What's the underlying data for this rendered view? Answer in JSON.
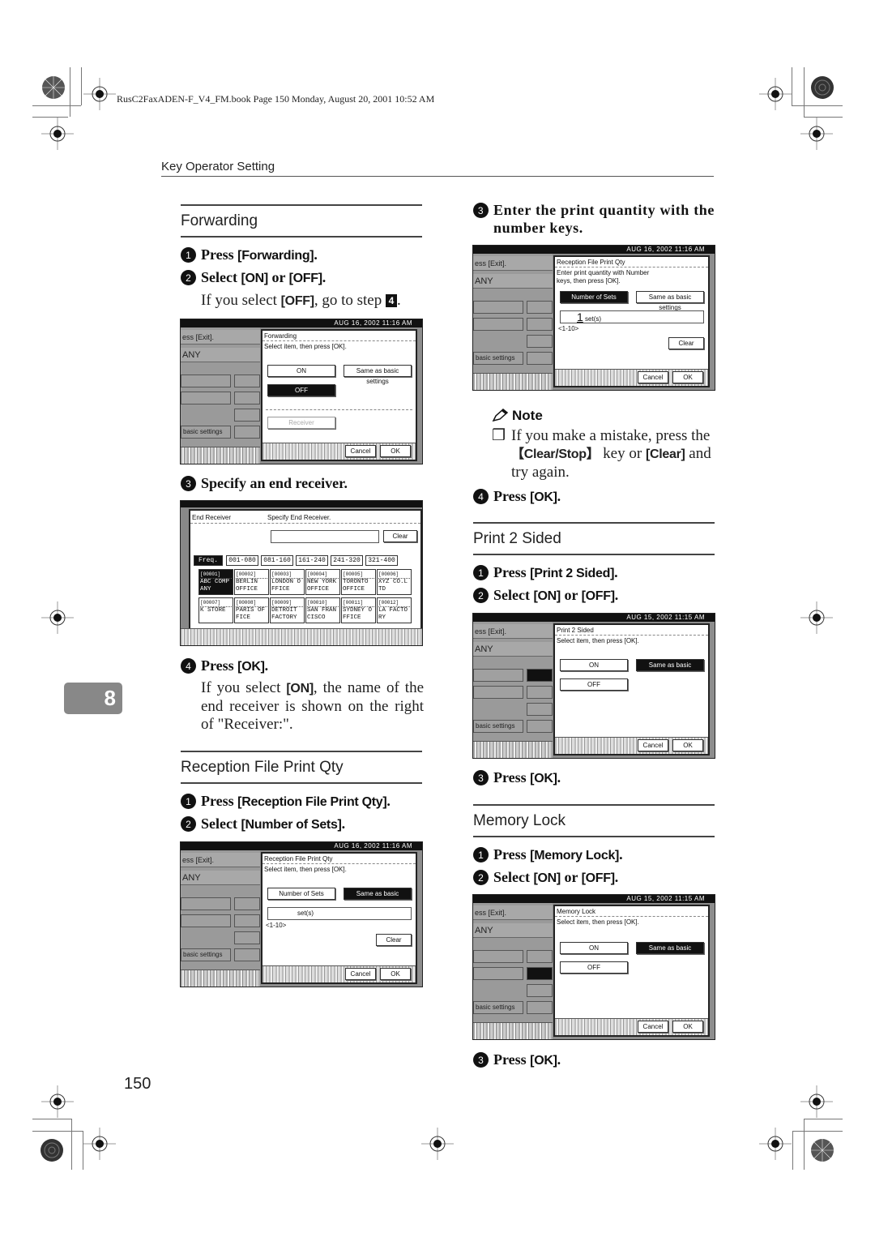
{
  "header": {
    "book_info": "RusC2FaxADEN-F_V4_FM.book  Page 150  Monday, August 20, 2001  10:52 AM",
    "running_head": "Key Operator Setting"
  },
  "chapter_tab": "8",
  "page_number": "150",
  "sections": {
    "forwarding": {
      "title": "Forwarding",
      "step1": {
        "num": "1",
        "pre": "Press ",
        "key": "[Forwarding]",
        "post": "."
      },
      "step2": {
        "num": "2",
        "pre": "Select ",
        "key1": "[ON]",
        "mid": " or ",
        "key2": "[OFF]",
        "post": "."
      },
      "step2_note": {
        "pre": "If you select ",
        "key": "[OFF]",
        "post": ", go to step ",
        "ref": "4",
        "end": "."
      },
      "panel": {
        "datetime": "AUG 16, 2002  11:16 AM",
        "left_row1": "ess [Exit].",
        "left_row2": "ANY",
        "left_basic": "basic settings",
        "dialog_title": "Forwarding",
        "dialog_sub": "Select item, then press [OK].",
        "btn_on": "ON",
        "btn_off": "OFF",
        "btn_same": "Same as basic settings",
        "btn_receiver": "Receiver",
        "btn_cancel": "Cancel",
        "btn_ok": "OK"
      },
      "step3": {
        "num": "3",
        "text": "Specify an end receiver."
      },
      "end_receiver": {
        "title": "End Receiver",
        "subtitle": "Specify End Receiver.",
        "clear": "Clear",
        "tabs": [
          "Freq.",
          "001-080",
          "081-160",
          "161-240",
          "241-320",
          "321-400"
        ],
        "destinations": [
          {
            "code": "[00001]",
            "name": "ABC COMP ANY"
          },
          {
            "code": "[00002]",
            "name": "BERLIN OFFICE"
          },
          {
            "code": "[00003]",
            "name": "LONDON O FFICE"
          },
          {
            "code": "[00004]",
            "name": "NEW YORK OFFICE"
          },
          {
            "code": "[00005]",
            "name": "TORONTO OFFICE"
          },
          {
            "code": "[00006]",
            "name": "XYZ CO.L TD"
          },
          {
            "code": "[00007]",
            "name": "K STORE"
          },
          {
            "code": "[00008]",
            "name": "PARIS OF FICE"
          },
          {
            "code": "[00009]",
            "name": "DETROIT FACTORY"
          },
          {
            "code": "[00010]",
            "name": "SAN FRAN CISCO"
          },
          {
            "code": "[00011]",
            "name": "SYDNEY O FFICE"
          },
          {
            "code": "[00012]",
            "name": "LA FACTO RY"
          }
        ]
      },
      "step4": {
        "num": "4",
        "pre": "Press ",
        "key": "[OK]",
        "post": "."
      },
      "step4_note": {
        "pre": "If you select ",
        "key": "[ON]",
        "post": ", the name of the end receiver is shown on the right of \"Receiver:\"."
      }
    },
    "reception_qty": {
      "title": "Reception File Print Qty",
      "step1": {
        "num": "1",
        "pre": "Press ",
        "key": "[Reception File Print Qty]",
        "post": "."
      },
      "step2": {
        "num": "2",
        "pre": "Select ",
        "key": "[Number of Sets]",
        "post": "."
      },
      "panel": {
        "datetime": "AUG 16, 2002  11:16 AM",
        "left_row1": "ess [Exit].",
        "left_row2": "ANY",
        "left_basic": "basic settings",
        "dialog_title": "Reception File Print Qty",
        "dialog_sub": "Select item, then press [OK].",
        "btn_sets": "Number of Sets",
        "btn_same": "Same as basic settings",
        "input_value": "",
        "input_unit": "set(s)",
        "range": "<1-10>",
        "btn_clear": "Clear",
        "btn_cancel": "Cancel",
        "btn_ok": "OK"
      },
      "step3": {
        "num": "3",
        "text": "Enter the print quantity with the number keys."
      },
      "panel2": {
        "datetime": "AUG 16, 2002  11:16 AM",
        "left_row1": "ess [Exit].",
        "left_row2": "ANY",
        "left_basic": "basic settings",
        "dialog_title": "Reception File Print Qty",
        "dialog_sub": "Enter print quantity with Number keys, then press [OK].",
        "btn_sets": "Number of Sets",
        "btn_same": "Same as basic settings",
        "input_value": "1",
        "input_unit": "set(s)",
        "range": "<1-10>",
        "btn_clear": "Clear",
        "btn_cancel": "Cancel",
        "btn_ok": "OK"
      },
      "note": {
        "label": "Note",
        "pre": "If you make a mistake, press the ",
        "key1": "【Clear/Stop】",
        "mid": " key or ",
        "key2": "[Clear]",
        "post": " and try again."
      },
      "step4": {
        "num": "4",
        "pre": "Press ",
        "key": "[OK]",
        "post": "."
      }
    },
    "print2sided": {
      "title": "Print 2 Sided",
      "step1": {
        "num": "1",
        "pre": "Press ",
        "key": "[Print 2 Sided]",
        "post": "."
      },
      "step2": {
        "num": "2",
        "pre": "Select ",
        "key1": "[ON]",
        "mid": " or ",
        "key2": "[OFF]",
        "post": "."
      },
      "panel": {
        "datetime": "AUG 15, 2002  11:15 AM",
        "left_row1": "ess [Exit].",
        "left_row2": "ANY",
        "left_basic": "basic settings",
        "dialog_title": "Print 2 Sided",
        "dialog_sub": "Select item, then press [OK].",
        "btn_on": "ON",
        "btn_off": "OFF",
        "btn_same": "Same as basic settings",
        "btn_cancel": "Cancel",
        "btn_ok": "OK"
      },
      "step3": {
        "num": "3",
        "pre": "Press ",
        "key": "[OK]",
        "post": "."
      }
    },
    "memory_lock": {
      "title": "Memory Lock",
      "step1": {
        "num": "1",
        "pre": "Press ",
        "key": "[Memory Lock]",
        "post": "."
      },
      "step2": {
        "num": "2",
        "pre": "Select ",
        "key1": "[ON]",
        "mid": " or ",
        "key2": "[OFF]",
        "post": "."
      },
      "panel": {
        "datetime": "AUG 15, 2002  11:15 AM",
        "left_row1": "ess [Exit].",
        "left_row2": "ANY",
        "left_basic": "basic settings",
        "dialog_title": "Memory Lock",
        "dialog_sub": "Select item, then press [OK].",
        "btn_on": "ON",
        "btn_off": "OFF",
        "btn_same": "Same as basic settings",
        "btn_cancel": "Cancel",
        "btn_ok": "OK"
      },
      "step3": {
        "num": "3",
        "pre": "Press ",
        "key": "[OK]",
        "post": "."
      }
    }
  }
}
